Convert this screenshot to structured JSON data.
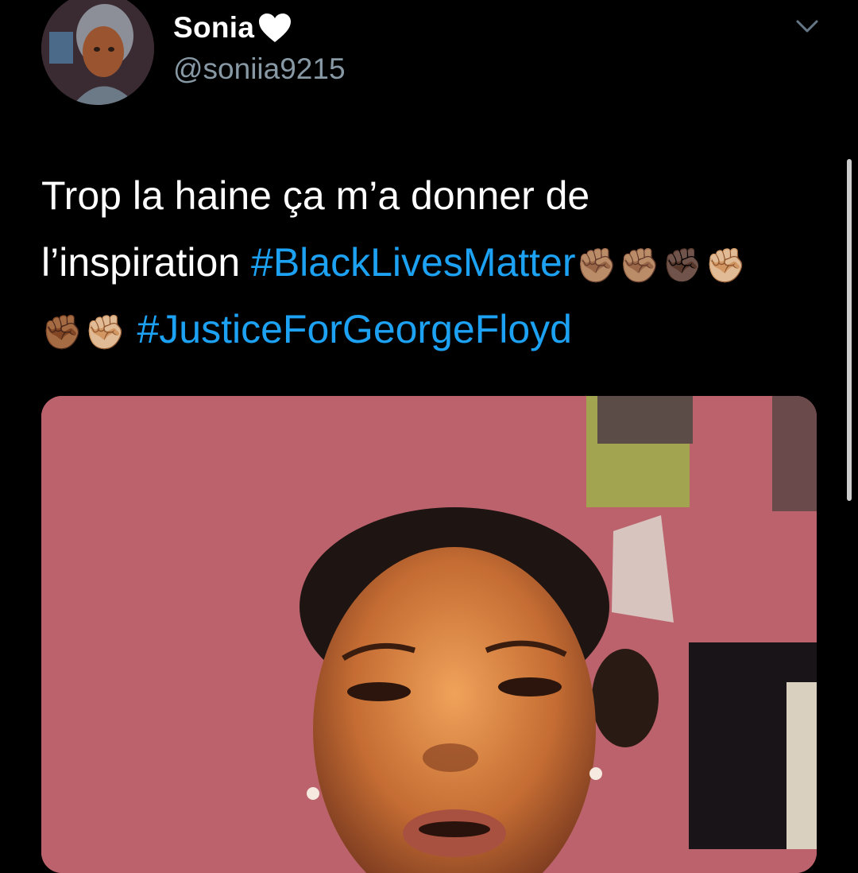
{
  "author": {
    "display_name": "Sonia",
    "handle": "@soniia9215",
    "name_emoji": "white-heart-icon"
  },
  "tweet": {
    "line1": "Trop la haine ça m’a donner de",
    "line2_text": "l’inspiration ",
    "hashtag1": "#BlackLivesMatter",
    "hashtag2": "#JusticeForGeorgeFloyd",
    "fists_after_hashtag1": [
      "✊🏽",
      "✊🏽",
      "✊🏿",
      "✊🏼"
    ],
    "fists_before_hashtag2": [
      "✊🏾",
      "✊🏼"
    ]
  },
  "media": {
    "type": "video-thumbnail"
  },
  "colors": {
    "background": "#000000",
    "text": "#ffffff",
    "secondary": "#8899a6",
    "link": "#1da1f2"
  }
}
